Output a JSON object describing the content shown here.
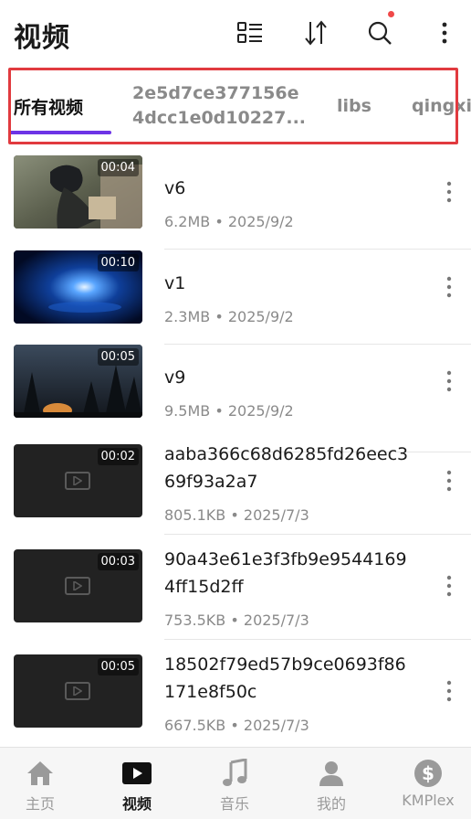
{
  "header": {
    "title": "视频",
    "icons": [
      "grid-list-icon",
      "sort-icon",
      "search-icon",
      "more-vertical-icon"
    ],
    "notification_dot_color": "#f04848"
  },
  "tabs": [
    {
      "label": "所有视频",
      "active": true
    },
    {
      "label_line1": "2e5d7ce377156e",
      "label_line2": "4dcc1e0d10227..."
    },
    {
      "label": "libs"
    },
    {
      "label": "qingxia"
    }
  ],
  "accent_color": "#6d34e6",
  "highlight_frame_color": "#e13a3f",
  "videos": [
    {
      "name": "v6",
      "duration": "00:04",
      "meta": "6.2MB • 2025/9/2",
      "thumb": "anime"
    },
    {
      "name": "v1",
      "duration": "00:10",
      "meta": "2.3MB • 2025/9/2",
      "thumb": "blue-light"
    },
    {
      "name": "v9",
      "duration": "00:05",
      "meta": "9.5MB • 2025/9/2",
      "thumb": "night-forest"
    },
    {
      "name_line1": "aaba366c68d6285fd26eec3",
      "name_line2": "69f93a2a7",
      "duration": "00:02",
      "meta": "805.1KB • 2025/7/3",
      "thumb": "placeholder"
    },
    {
      "name_line1": "90a43e61e3f3fb9e9544169",
      "name_line2": "4ff15d2ff",
      "duration": "00:03",
      "meta": "753.5KB • 2025/7/3",
      "thumb": "placeholder"
    },
    {
      "name_line1": "18502f79ed57b9ce0693f86",
      "name_line2": "171e8f50c",
      "duration": "00:05",
      "meta": "667.5KB • 2025/7/3",
      "thumb": "placeholder"
    }
  ],
  "bottom_nav": [
    {
      "label": "主页",
      "icon": "home-icon"
    },
    {
      "label": "视频",
      "icon": "video-play-icon",
      "active": true
    },
    {
      "label": "音乐",
      "icon": "music-note-icon"
    },
    {
      "label": "我的",
      "icon": "person-icon"
    },
    {
      "label": "KMPlex",
      "icon": "dollar-circle-icon"
    }
  ]
}
